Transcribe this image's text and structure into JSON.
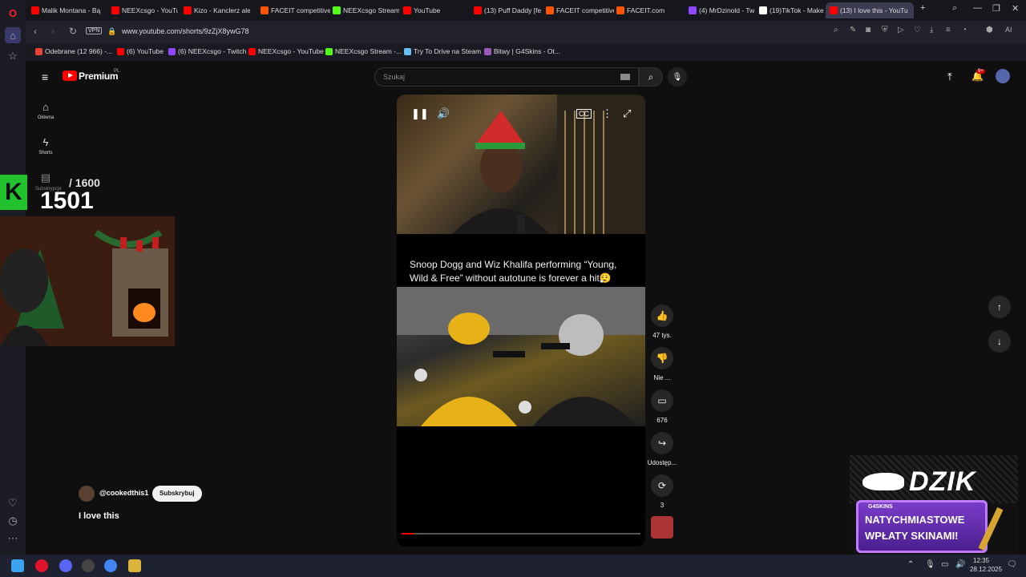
{
  "browser": {
    "tabs": [
      {
        "title": "Malik Montana - Bą",
        "color": "#ff0000"
      },
      {
        "title": "NEEXcsgo - YouTub",
        "color": "#ff0000"
      },
      {
        "title": "Kizo - Kanclerz ale",
        "color": "#ff0000"
      },
      {
        "title": "FACEIT competitive",
        "color": "#ff5500"
      },
      {
        "title": "NEEXcsgo Stream",
        "color": "#53fc18"
      },
      {
        "title": "YouTube",
        "color": "#ff0000"
      },
      {
        "title": "(13) Puff Daddy [fe",
        "color": "#ff0000"
      },
      {
        "title": "FACEIT competitive",
        "color": "#ff5500"
      },
      {
        "title": "FACEIT.com",
        "color": "#ff5500"
      },
      {
        "title": "(4) MrDzinold - Tw",
        "color": "#9146ff"
      },
      {
        "title": "(19)TikTok - Make Y",
        "color": "#ffffff"
      },
      {
        "title": "(13) I love this - YouTu",
        "color": "#ff0000"
      }
    ],
    "url": "www.youtube.com/shorts/9zZjX8ywG78",
    "vpn_label": "VPN",
    "bookmarks": [
      {
        "label": "Odebrane (12 966) -...",
        "color": "#ea4335"
      },
      {
        "label": "(6) YouTube",
        "color": "#ff0000"
      },
      {
        "label": "(6) NEEXcsgo - Twitch",
        "color": "#9146ff"
      },
      {
        "label": "NEEXcsgo - YouTube",
        "color": "#ff0000"
      },
      {
        "label": "NEEXcsgo Stream -...",
        "color": "#53fc18"
      },
      {
        "label": "Try To Drive na Steam",
        "color": "#1b2838"
      },
      {
        "label": "Bitwy | G4Skins - Ot...",
        "color": "#9b59b6"
      }
    ]
  },
  "youtube": {
    "logo": "Premium",
    "logo_sup": "PL",
    "search_placeholder": "Szukaj",
    "notif_badge": "9+",
    "rail": {
      "home": "Główna",
      "shorts": "Shorts",
      "subs": "Subskrypcje"
    },
    "short": {
      "caption": "Snoop Dogg and Wiz Khalifa performing “Young, Wild & Free” without autotune is forever a hit😮‍💨",
      "channel": "@cookedthis1",
      "subscribe": "Subskrybuj",
      "title": "I love this",
      "progress": 0.05
    },
    "actions": {
      "likes": "47 tys.",
      "dislike": "Nie ...",
      "comments": "676",
      "share": "Udostęp...",
      "remix": "3"
    }
  },
  "overlay": {
    "count_target": "/ 1600",
    "count_value": "1501",
    "dzik_brand": "DZIK",
    "promo_logo": "G4SKINS",
    "promo_text1": "NATYCHMIASTOWE",
    "promo_text2": "WPŁATY SKINAMI!"
  },
  "taskbar": {
    "time": "12:35",
    "date": "28.12.2025"
  }
}
